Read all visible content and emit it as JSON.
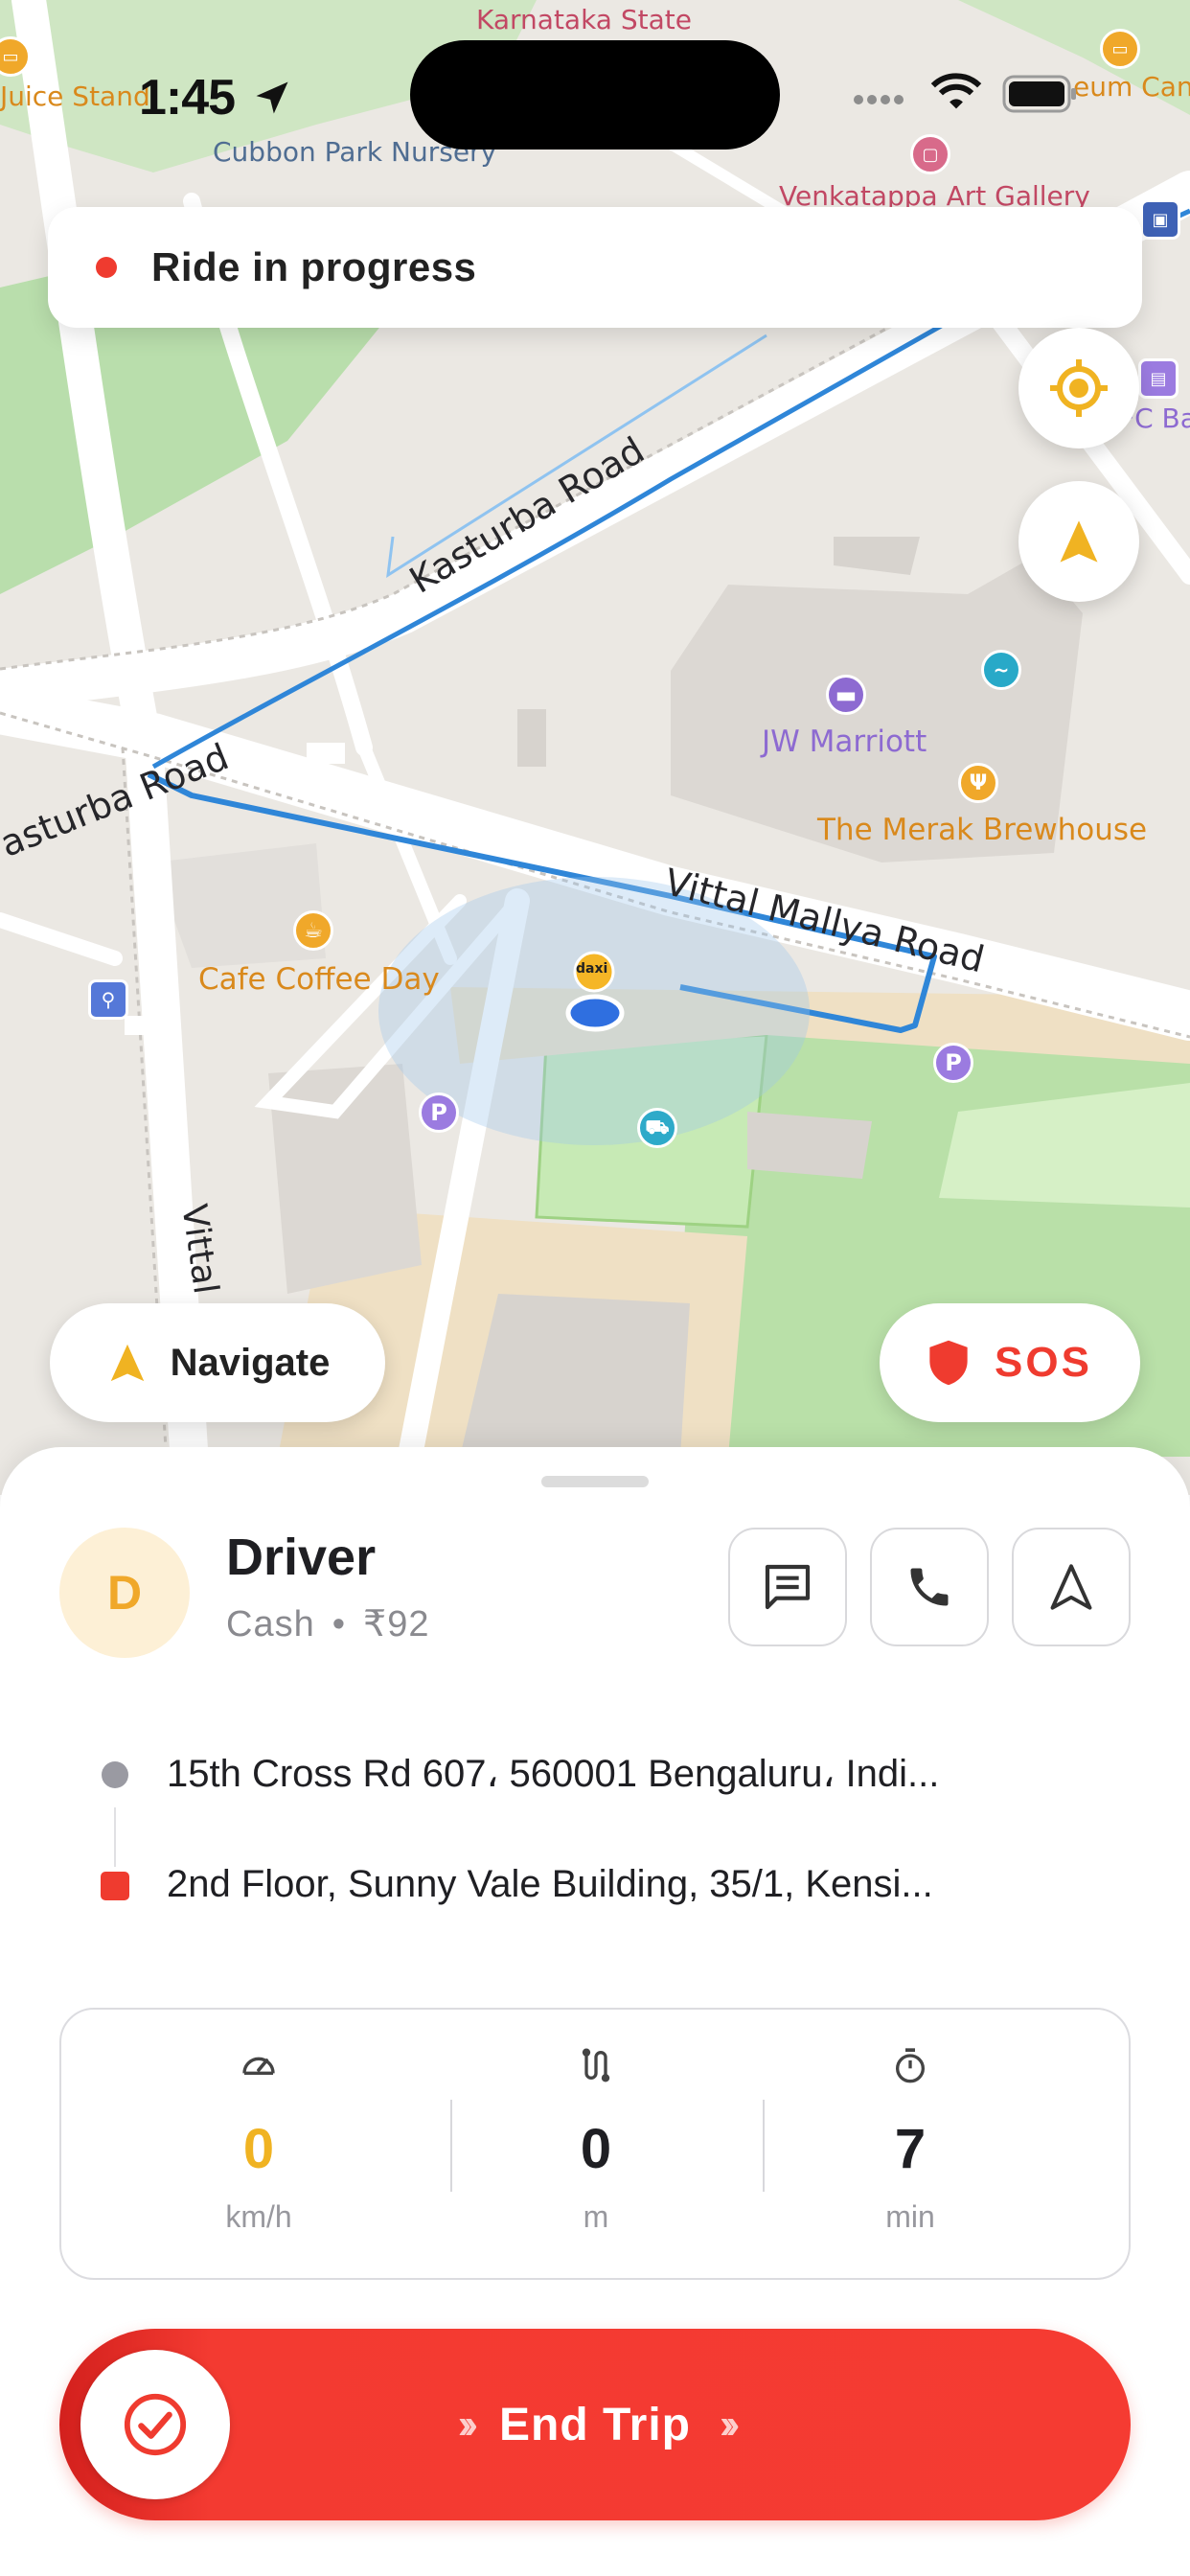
{
  "status_bar": {
    "time": "1:45"
  },
  "map": {
    "labels": {
      "karnataka_state": "Karnataka State",
      "juice_stand": "Juice Stand",
      "museum_cafe": "eum Cante",
      "cubbon_park_nursery": "Cubbon Park Nursery",
      "venkatappa": "Venkatappa Art Gallery",
      "kasturba_road_main": "Kasturba Road",
      "kasturba_road_left": "asturba Road",
      "jw_marriott": "JW Marriott",
      "merak": "The Merak Brewhouse",
      "vittal_mallya_road": "Vittal Mallya Road",
      "cafe_coffee_day": "Cafe Coffee Day",
      "vittal_side": "Vittal",
      "fc_bank": "FC Ba",
      "car_marker": "daxi",
      "parking": "P"
    },
    "colors": {
      "route": "#2f86d8",
      "park": "#b7dfa3",
      "road": "#ffffff",
      "accent": "#f0b322"
    }
  },
  "ride_banner": {
    "text": "Ride in progress",
    "status_color": "#ef3b2f"
  },
  "buttons": {
    "recenter_icon": "crosshair-icon",
    "heading_icon": "navigation-arrow-icon",
    "navigate_label": "Navigate",
    "sos_label": "SOS"
  },
  "driver": {
    "initial": "D",
    "name": "Driver",
    "payment": "Cash",
    "separator": "•",
    "fare": "₹92",
    "actions": [
      "message-icon",
      "phone-icon",
      "navigate-icon"
    ]
  },
  "addresses": {
    "pickup": "15th Cross Rd 607، 560001 Bengaluru، Indi...",
    "dropoff": "2nd Floor, Sunny Vale Building, 35/1, Kensi..."
  },
  "stats": {
    "speed": {
      "value": "0",
      "unit": "km/h",
      "icon": "speedometer-icon"
    },
    "distance": {
      "value": "0",
      "unit": "m",
      "icon": "route-icon"
    },
    "time": {
      "value": "7",
      "unit": "min",
      "icon": "stopwatch-icon"
    }
  },
  "end_trip": {
    "label": "End Trip",
    "color": "#f53b32"
  }
}
